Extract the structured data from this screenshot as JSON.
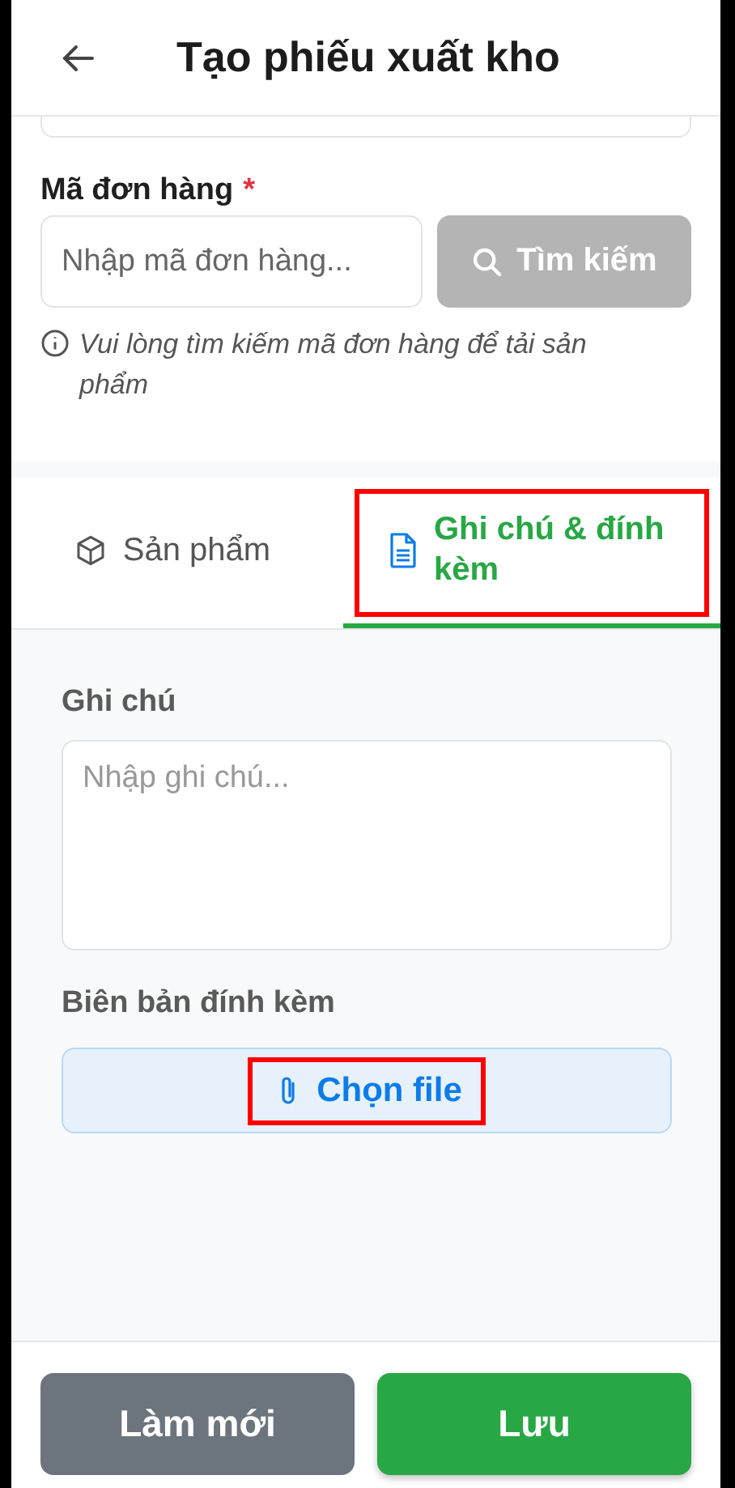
{
  "header": {
    "title": "Tạo phiếu xuất kho"
  },
  "order_code": {
    "label": "Mã đơn hàng",
    "required_mark": "*",
    "placeholder": "Nhập mã đơn hàng...",
    "search_button": {
      "label": "Tìm kiếm",
      "disabled": true
    },
    "hint": "Vui lòng tìm kiếm mã đơn hàng để tải sản phẩm"
  },
  "tabs": [
    {
      "label": "Sản phẩm",
      "kind": "products",
      "selected": false,
      "highlighted": false
    },
    {
      "label": "Ghi chú & đính kèm",
      "kind": "notes",
      "selected": true,
      "highlighted": true
    }
  ],
  "notes": {
    "label": "Ghi chú",
    "placeholder": "Nhập ghi chú..."
  },
  "attachment": {
    "label": "Biên bản đính kèm",
    "button": {
      "label": "Chọn file",
      "highlighted": true
    }
  },
  "footer": {
    "buttons": [
      {
        "label": "Làm mới",
        "kind": "secondary"
      },
      {
        "label": "Lưu",
        "kind": "primary"
      }
    ]
  }
}
